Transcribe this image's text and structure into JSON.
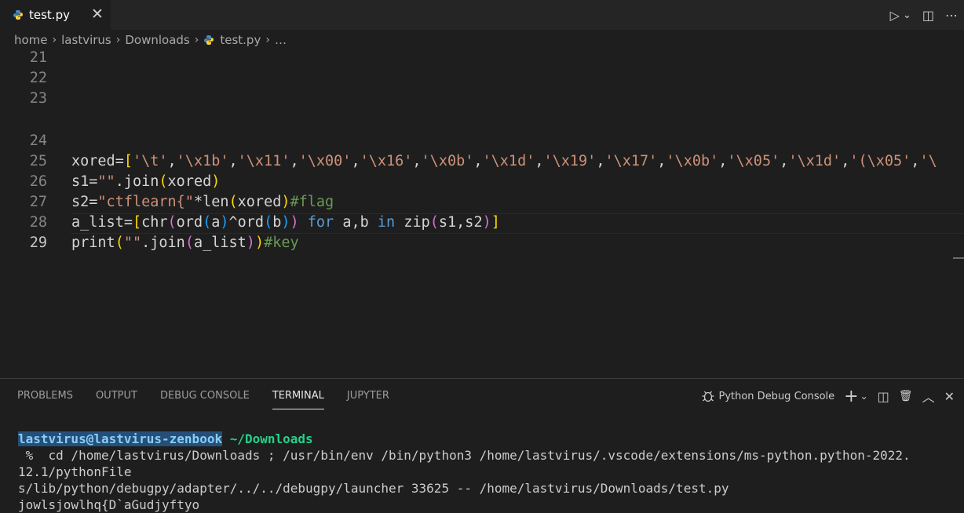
{
  "tab": {
    "title": "test.py",
    "close": "✕"
  },
  "tab_actions": {
    "run": "▷",
    "run_menu": "⌄",
    "split": "◫",
    "more": "⋯"
  },
  "breadcrumb": {
    "items": [
      "home",
      "lastvirus",
      "Downloads"
    ],
    "file": "test.py",
    "more": "…",
    "sep": "›"
  },
  "editor": {
    "line_numbers": [
      "21",
      "22",
      "23",
      "24",
      "25",
      "26",
      "27",
      "28",
      "29"
    ]
  },
  "panel": {
    "tabs": [
      "PROBLEMS",
      "OUTPUT",
      "DEBUG CONSOLE",
      "TERMINAL",
      "JUPYTER"
    ],
    "active_tab": "TERMINAL",
    "terminal_name": "Python Debug Console",
    "actions": {
      "add": "+",
      "add_menu": "⌄",
      "split": "◫",
      "trash": "🗑",
      "maximize": "︿",
      "close": "✕"
    }
  },
  "terminal": {
    "user": "lastvirus@lastvirus-zenbook",
    "cwd": " ~/Downloads",
    "lines": [
      " %  cd /home/lastvirus/Downloads ; /usr/bin/env /bin/python3 /home/lastvirus/.vscode/extensions/ms-python.python-2022.",
      "12.1/pythonFile",
      "s/lib/python/debugpy/adapter/../../debugpy/launcher 33625 -- /home/lastvirus/Downloads/test.py",
      "jowlsjowlhq{D`aGudjyftyo"
    ]
  },
  "colors": {
    "accent": "#264f78",
    "cwd": "#23d18b",
    "string": "#ce9178",
    "keyword": "#569cd6",
    "comment": "#6a9955"
  },
  "code": {
    "l24": {
      "var": "xored=",
      "b": "[",
      "items": [
        "'\\t'",
        "'\\x1b'",
        "'\\x11'",
        "'\\x00'",
        "'\\x16'",
        "'\\x0b'",
        "'\\x1d'",
        "'\\x19'",
        "'\\x17'",
        "'\\x0b'",
        "'\\x05'",
        "'\\x1d'",
        "'(\\x05'",
        "'\\"
      ]
    },
    "l25": {
      "a": "s1=",
      "b": "\"\"",
      "c": ".join",
      "d": "(",
      "e": "xored",
      "f": ")"
    },
    "l26": {
      "a": "s2=",
      "b": "\"ctflearn{\"",
      "c": "*len",
      "d": "(",
      "e": "xored",
      "f": ")",
      "g": "#flag"
    },
    "l27": {
      "a": "a_list=",
      "b1": "[",
      "c": "chr",
      "b2": "(",
      "d": "ord",
      "b3": "(",
      "e": "a",
      "b3c": ")",
      "f": "^ord",
      "b3o": "(",
      "g": "b",
      "b3cc": ")",
      "b2c": ")",
      "h": " for ",
      "i": "a,b ",
      "j": "in ",
      "k": "zip",
      "b2o": "(",
      "l": "s1,s2",
      "b2cc": ")",
      "b1c": "]"
    },
    "l28": {
      "a": "print",
      "b1": "(",
      "b": "\"\"",
      "c": ".join",
      "b2": "(",
      "d": "a_list",
      "b2c": ")",
      "b1c": ")",
      "e": "#key"
    }
  }
}
